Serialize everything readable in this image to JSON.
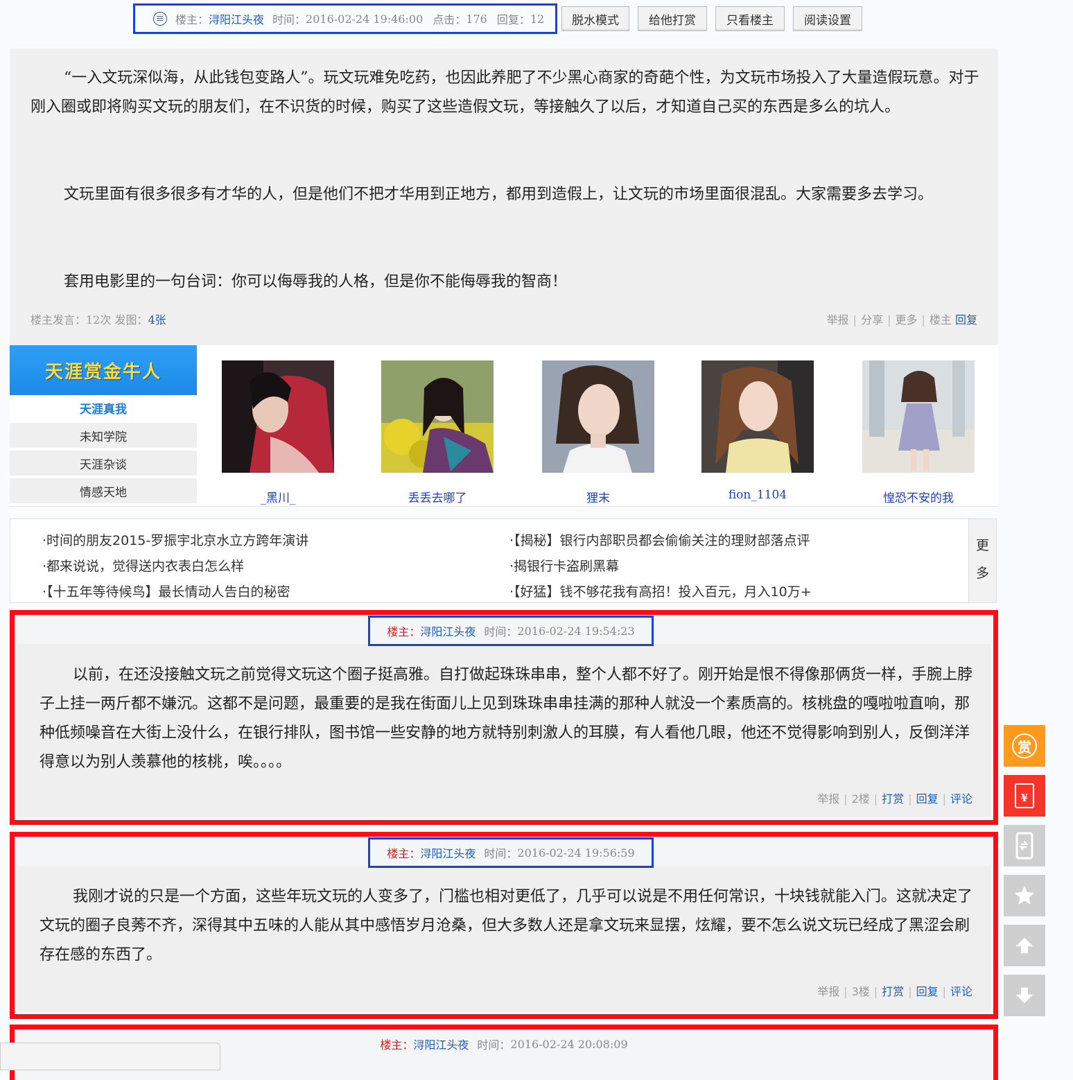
{
  "top": {
    "owner_label": "楼主：",
    "owner_name": "浔阳江头夜",
    "time_label": "时间：",
    "time": "2016-02-24 19:46:00",
    "clicks_label": "点击：",
    "clicks": "176",
    "replies_label": "回复：",
    "replies": "12",
    "buttons": [
      "脱水模式",
      "给他打赏",
      "只看楼主",
      "阅读设置"
    ]
  },
  "main_post": {
    "paragraphs": [
      "“一入文玩深似海，从此钱包变路人”。玩文玩难免吃药，也因此养肥了不少黑心商家的奇葩个性，为文玩市场投入了大量造假玩意。对于刚入圈或即将购买文玩的朋友们，在不识货的时候，购买了这些造假文玩，等接触久了以后，才知道自己买的东西是多么的坑人。",
      "文玩里面有很多很多有才华的人，但是他们不把才华用到正地方，都用到造假上，让文玩的市场里面很混乱。大家需要多去学习。",
      "套用电影里的一句台词：你可以侮辱我的人格，但是你不能侮辱我的智商！"
    ],
    "stats_prefix": "楼主发言：12次 发图：",
    "stats_pics": "4张",
    "actions": [
      "举报",
      "分享",
      "更多",
      "楼主"
    ],
    "reply_link": "回复"
  },
  "promo": {
    "title": "天涯赏金牛人",
    "nav": [
      "天涯真我",
      "未知学院",
      "天涯杂谈",
      "情感天地"
    ],
    "users": [
      "_黑川_",
      "丢丢去哪了",
      "狸末",
      "fion_1104",
      "惶恐不安的我"
    ]
  },
  "links": {
    "left": [
      "·时间的朋友2015-罗振宇北京水立方跨年演讲",
      "·都来说说，觉得送内衣表白怎么样",
      "·【十五年等待候鸟】最长情动人告白的秘密"
    ],
    "right": [
      "·【揭秘】银行内部职员都会偷偷关注的理财部落点评",
      "·揭银行卡盗刷黑幕",
      "·【好猛】钱不够花我有高招！投入百元，月入10万+"
    ],
    "more_1": "更",
    "more_2": "多"
  },
  "replies": [
    {
      "owner_label": "楼主：",
      "owner_name": "浔阳江头夜",
      "time_label": "时间：",
      "time": "2016-02-24 19:54:23",
      "text": "以前，在还没接触文玩之前觉得文玩这个圈子挺高雅。自打做起珠珠串串，整个人都不好了。刚开始是恨不得像那俩货一样，手腕上脖子上挂一两斤都不嫌沉。这都不是问题，最重要的是我在街面儿上见到珠珠串串挂满的那种人就没一个素质高的。核桃盘的嘎啦啦直响，那种低频噪音在大街上没什么，在银行排队，图书馆一些安静的地方就特别刺激人的耳膜，有人看他几眼，他还不觉得影响到别人，反倒洋洋得意以为别人羡慕他的核桃，唉。。。。",
      "report": "举报",
      "floor": "2楼",
      "tip": "打赏",
      "reply": "回复",
      "comment": "评论"
    },
    {
      "owner_label": "楼主：",
      "owner_name": "浔阳江头夜",
      "time_label": "时间：",
      "time": "2016-02-24 19:56:59",
      "text": "我刚才说的只是一个方面，这些年玩文玩的人变多了，门槛也相对更低了，几乎可以说是不用任何常识，十块钱就能入门。这就决定了文玩的圈子良莠不齐，深得其中五味的人能从其中感悟岁月沧桑，但大多数人还是拿文玩来显摆，炫耀，要不怎么说文玩已经成了黑涩会刷存在感的东西了。",
      "report": "举报",
      "floor": "3楼",
      "tip": "打赏",
      "reply": "回复",
      "comment": "评论"
    },
    {
      "owner_label": "楼主：",
      "owner_name": "浔阳江头夜",
      "time_label": "时间：",
      "time": "2016-02-24 20:08:09"
    }
  ],
  "side": {
    "reward_glyph": "赏",
    "redpacket_glyph": "¥"
  },
  "colors": {
    "highlight_red": "#ff0d17",
    "highlight_blue": "#1a3fe6",
    "link_blue": "#1f5db8",
    "owner_red": "#e21a1a"
  }
}
